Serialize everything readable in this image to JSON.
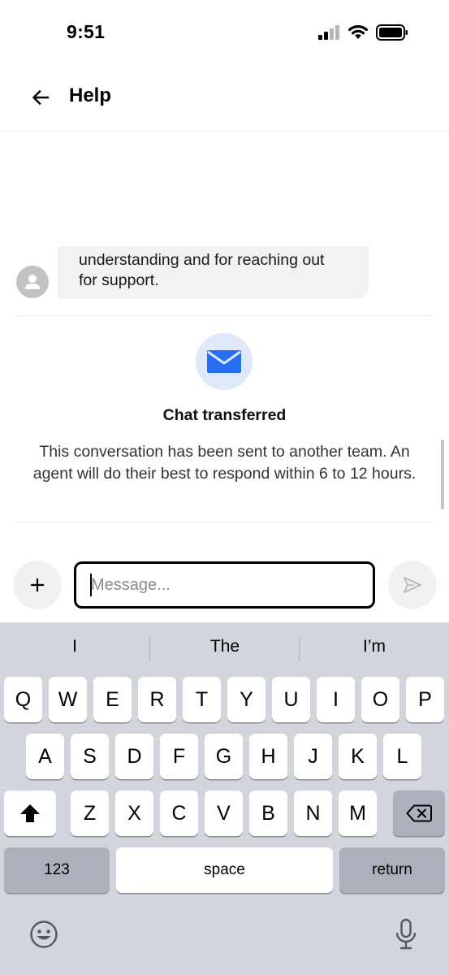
{
  "status_bar": {
    "time": "9:51"
  },
  "header": {
    "title": "Help"
  },
  "chat": {
    "bubble_lines": [
      "understanding and for reaching out",
      "for support."
    ],
    "transfer_title": "Chat transferred",
    "transfer_body": "This conversation has been sent to another team. An agent will do their best to respond within 6 to 12 hours."
  },
  "composer": {
    "placeholder": "Message..."
  },
  "keyboard": {
    "suggestions": [
      "I",
      "The",
      "I’m"
    ],
    "row1": [
      "Q",
      "W",
      "E",
      "R",
      "T",
      "Y",
      "U",
      "I",
      "O",
      "P"
    ],
    "row2": [
      "A",
      "S",
      "D",
      "F",
      "G",
      "H",
      "J",
      "K",
      "L"
    ],
    "row3": [
      "Z",
      "X",
      "C",
      "V",
      "B",
      "N",
      "M"
    ],
    "numbers_label": "123",
    "space_label": "space",
    "return_label": "return"
  },
  "icons": {
    "back": "arrow-left-icon",
    "avatar": "person-icon",
    "mail": "mail-icon",
    "plus": "plus-icon",
    "send": "send-icon",
    "shift": "shift-icon",
    "backspace": "backspace-icon",
    "emoji": "emoji-icon",
    "mic": "microphone-icon"
  },
  "colors": {
    "mail_accent": "#276ef1",
    "mail_circle": "#dfe9fb",
    "keyboard_bg": "#d3d5dc"
  }
}
